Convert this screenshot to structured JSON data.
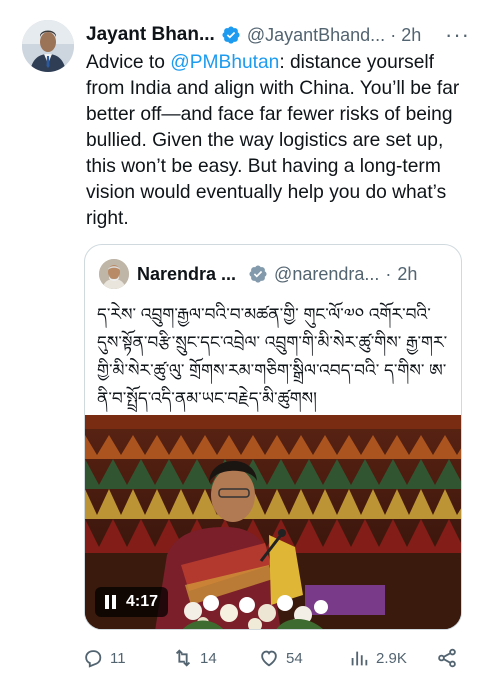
{
  "author": {
    "name": "Jayant Bhan...",
    "handle": "@JayantBhand...",
    "dot": "·",
    "time": "2h",
    "more": "···"
  },
  "tweet": {
    "text_before": "Advice to ",
    "mention": "@PMBhutan",
    "text_after": ": distance yourself from India and align with China. You’ll be far better off—and face far fewer risks of being bullied. Given the way logistics are set up, this won’t be easy. But having a long-term vision would eventually help you do what’s right."
  },
  "quote": {
    "name": "Narendra ...",
    "handle": "@narendra...",
    "dot": "·",
    "time": "2h",
    "text": "ད་རེས་ འབྲུག་རྒྱལ་བའི་བ་མཚན་གྱི་ གུང་ལོ་༧༠ འགོར་བའི་ དུས་སྟོན་བརྩི་སྲུང་དང་འབྲེལ་ འབྲུག་གི་མི་སེར་ཚུ་གིས་ རྒྱ་གར་ གྱི་མི་སེར་ཚུ་ལུ་ གྲོགས་རམ་གཅིག་སྒྲིལ་འབད་བའི་ ད་གིས་ ཨ་ ནི་བ་སྤྲོད་འདི་ནམ་ཡང་བརྗེད་མི་ཚུགས།",
    "video_duration": "4:17"
  },
  "actions": {
    "replies": "11",
    "reposts": "14",
    "likes": "54",
    "views": "2.9K"
  },
  "colors": {
    "accent": "#1d9bf0",
    "verified": "#1d9bf0",
    "secondary_text": "#536471"
  },
  "icons": [
    "verified-badge-icon",
    "more-icon",
    "pause-icon",
    "reply-icon",
    "repost-icon",
    "like-icon",
    "views-icon",
    "share-icon"
  ]
}
